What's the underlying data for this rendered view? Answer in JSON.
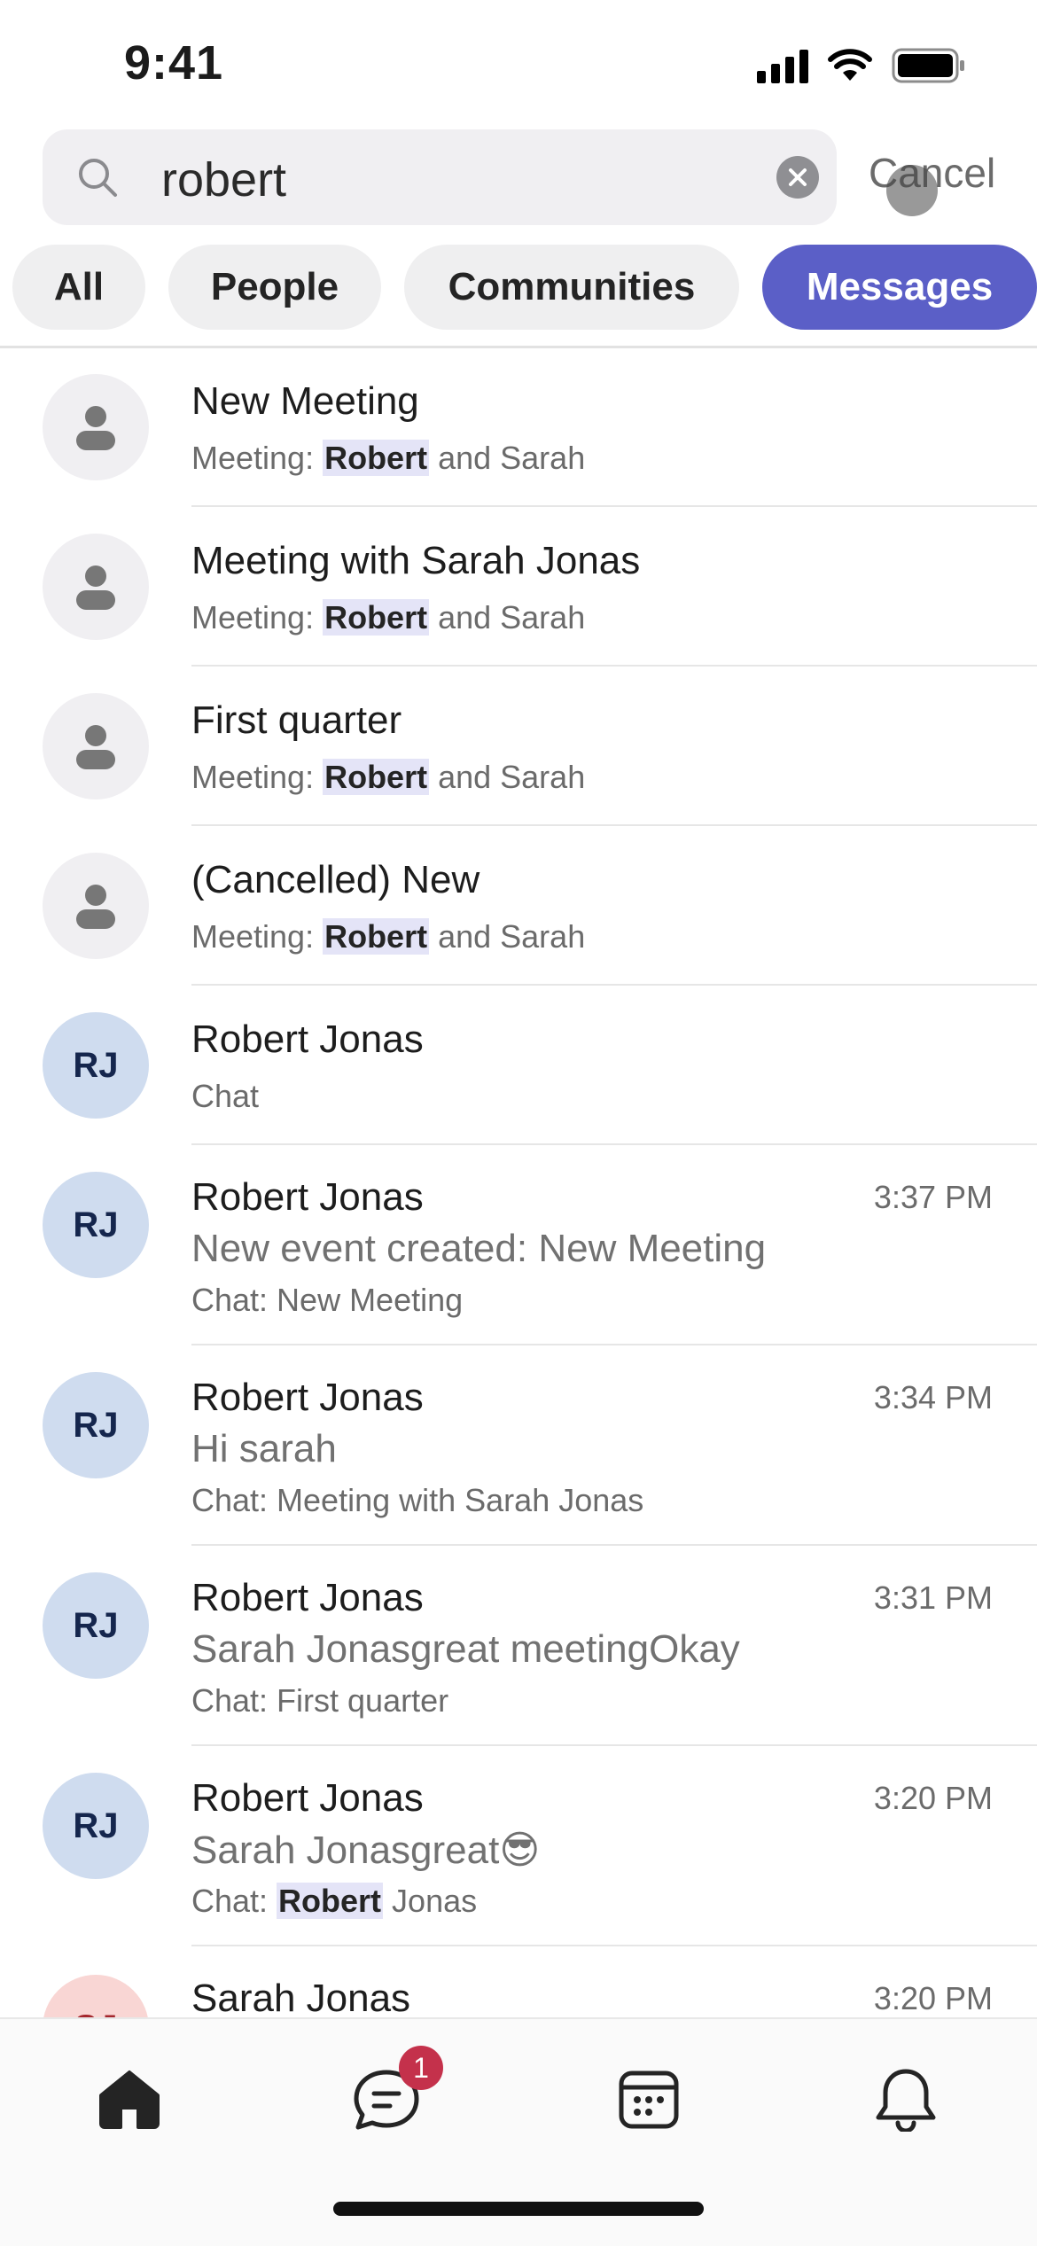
{
  "status": {
    "time": "9:41"
  },
  "search": {
    "value": "robert",
    "cancel_label": "Cancel"
  },
  "filters": [
    {
      "label": "All"
    },
    {
      "label": "People"
    },
    {
      "label": "Communities"
    },
    {
      "label": "Messages",
      "active": true
    }
  ],
  "results": [
    {
      "type": "meeting",
      "title": "New Meeting",
      "sub_prefix": "Meeting: ",
      "sub_highlight": "Robert",
      "sub_suffix": " and Sarah"
    },
    {
      "type": "meeting",
      "title": "Meeting with Sarah Jonas",
      "sub_prefix": "Meeting: ",
      "sub_highlight": "Robert",
      "sub_suffix": " and Sarah"
    },
    {
      "type": "meeting",
      "title": "First quarter",
      "sub_prefix": "Meeting: ",
      "sub_highlight": "Robert",
      "sub_suffix": " and Sarah"
    },
    {
      "type": "meeting",
      "title": "(Cancelled) New",
      "sub_prefix": "Meeting: ",
      "sub_highlight": "Robert",
      "sub_suffix": " and Sarah"
    },
    {
      "type": "chat",
      "initials": "RJ",
      "title": "Robert Jonas",
      "sub": "Chat"
    },
    {
      "type": "message",
      "initials": "RJ",
      "title": "Robert Jonas",
      "time": "3:37 PM",
      "preview": "New event created: New Meeting",
      "context": "Chat: New Meeting"
    },
    {
      "type": "message",
      "initials": "RJ",
      "title": "Robert Jonas",
      "time": "3:34 PM",
      "preview": "Hi sarah",
      "context": "Chat: Meeting with Sarah Jonas"
    },
    {
      "type": "message",
      "initials": "RJ",
      "title": "Robert Jonas",
      "time": "3:31 PM",
      "preview": "Sarah Jonasgreat meetingOkay",
      "context": "Chat: First quarter"
    },
    {
      "type": "message",
      "initials": "RJ",
      "title": "Robert Jonas",
      "time": "3:20 PM",
      "preview": "Sarah Jonasgreat",
      "preview_emoji": "😎",
      "context_prefix": "Chat: ",
      "context_highlight": "Robert",
      "context_suffix": " Jonas"
    },
    {
      "type": "message",
      "initials": "SJ",
      "title": "Sarah Jonas",
      "time": "3:20 PM"
    }
  ],
  "tabbar": {
    "items": [
      {
        "icon": "home-icon"
      },
      {
        "icon": "chat-icon",
        "badge": "1"
      },
      {
        "icon": "calendar-icon"
      },
      {
        "icon": "bell-icon"
      }
    ]
  },
  "colors": {
    "accent": "#5b5fc7",
    "highlight": "#e4e4f7",
    "badge": "#c4314b"
  }
}
